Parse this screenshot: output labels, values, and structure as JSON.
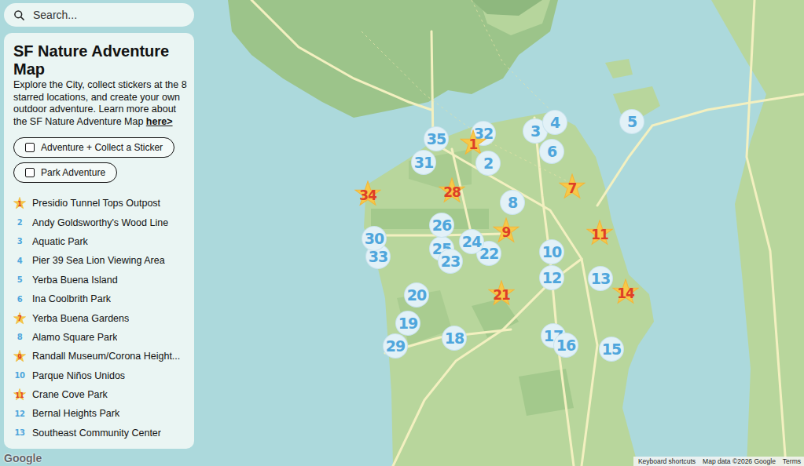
{
  "search": {
    "placeholder": "Search..."
  },
  "sidebar": {
    "title": "SF Nature Adventure Map",
    "description": "Explore the City, collect stickers at the 8 starred locations, and create your own outdoor adventure. Learn more about the SF Nature Adventure Map ",
    "link": "here>",
    "filters": [
      {
        "label": "Adventure + Collect a Sticker",
        "checked": false
      },
      {
        "label": "Park Adventure",
        "checked": false
      }
    ],
    "items": [
      {
        "number": "1",
        "name": "Presidio Tunnel Tops Outpost",
        "kind": "star"
      },
      {
        "number": "2",
        "name": "Andy Goldsworthy's Wood Line",
        "kind": "circle"
      },
      {
        "number": "3",
        "name": "Aquatic Park",
        "kind": "circle"
      },
      {
        "number": "4",
        "name": "Pier 39 Sea Lion Viewing Area",
        "kind": "circle"
      },
      {
        "number": "5",
        "name": "Yerba Buena Island",
        "kind": "circle"
      },
      {
        "number": "6",
        "name": "Ina Coolbrith Park",
        "kind": "circle"
      },
      {
        "number": "7",
        "name": "Yerba Buena Gardens",
        "kind": "star"
      },
      {
        "number": "8",
        "name": "Alamo Square Park",
        "kind": "circle"
      },
      {
        "number": "9",
        "name": "Randall Museum/Corona Height...",
        "kind": "star"
      },
      {
        "number": "10",
        "name": "Parque Niños Unidos",
        "kind": "circle"
      },
      {
        "number": "11",
        "name": "Crane Cove Park",
        "kind": "star"
      },
      {
        "number": "12",
        "name": "Bernal Heights Park",
        "kind": "circle"
      },
      {
        "number": "13",
        "name": "Southeast Community Center",
        "kind": "circle"
      }
    ]
  },
  "map": {
    "pins": [
      {
        "label": "32",
        "kind": "circle"
      },
      {
        "label": "33",
        "kind": "circle"
      },
      {
        "label": "1",
        "kind": "star"
      },
      {
        "label": "2",
        "kind": "circle"
      },
      {
        "label": "3",
        "kind": "circle"
      },
      {
        "label": "4",
        "kind": "circle"
      },
      {
        "label": "5",
        "kind": "circle"
      },
      {
        "label": "6",
        "kind": "circle"
      },
      {
        "label": "7",
        "kind": "star"
      },
      {
        "label": "8",
        "kind": "circle"
      },
      {
        "label": "9",
        "kind": "star"
      },
      {
        "label": "10",
        "kind": "circle"
      },
      {
        "label": "11",
        "kind": "star"
      },
      {
        "label": "12",
        "kind": "circle"
      },
      {
        "label": "13",
        "kind": "circle"
      },
      {
        "label": "14",
        "kind": "star"
      },
      {
        "label": "15",
        "kind": "circle"
      },
      {
        "label": "17",
        "kind": "circle"
      },
      {
        "label": "16",
        "kind": "circle"
      },
      {
        "label": "18",
        "kind": "circle"
      },
      {
        "label": "19",
        "kind": "circle"
      },
      {
        "label": "20",
        "kind": "circle"
      },
      {
        "label": "21",
        "kind": "star"
      },
      {
        "label": "22",
        "kind": "circle"
      },
      {
        "label": "25",
        "kind": "circle"
      },
      {
        "label": "23",
        "kind": "circle"
      },
      {
        "label": "24",
        "kind": "circle"
      },
      {
        "label": "26",
        "kind": "circle"
      },
      {
        "label": "28",
        "kind": "star"
      },
      {
        "label": "29",
        "kind": "circle"
      },
      {
        "label": "30",
        "kind": "circle"
      },
      {
        "label": "31",
        "kind": "circle"
      },
      {
        "label": "34",
        "kind": "star"
      },
      {
        "label": "35",
        "kind": "circle"
      }
    ]
  },
  "footer": {
    "logo": "Google",
    "links": [
      "Keyboard shortcuts",
      "Map data ©2026 Google",
      "Terms"
    ]
  }
}
